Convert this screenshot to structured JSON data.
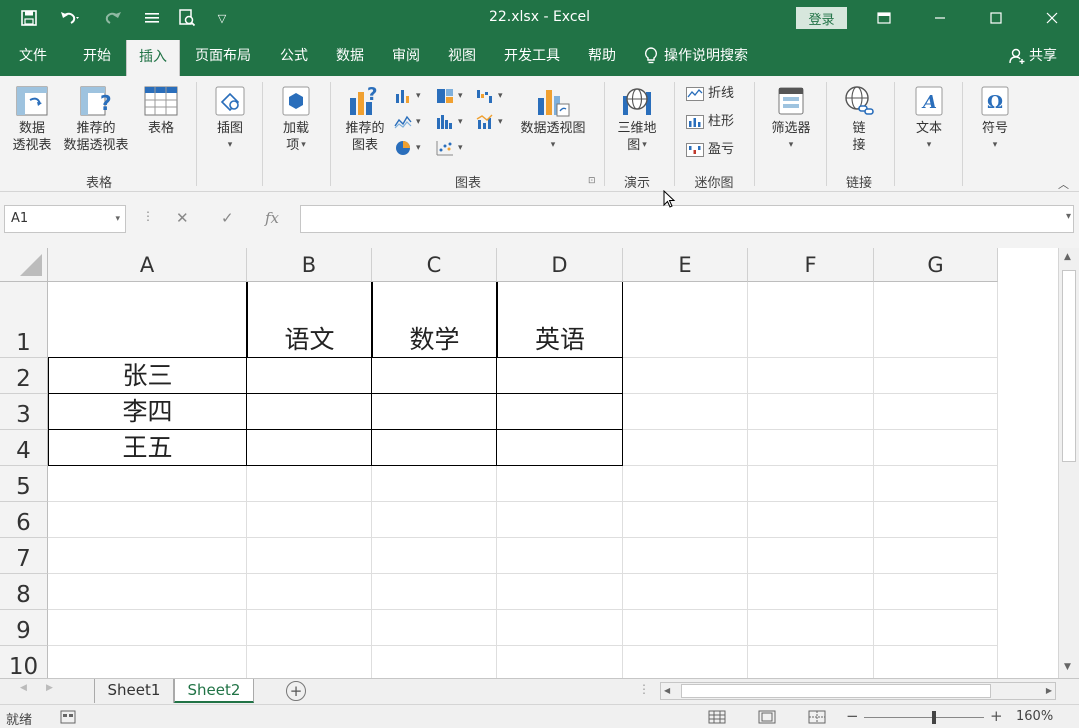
{
  "window": {
    "title": "22.xlsx - Excel",
    "login_label": "登录"
  },
  "tabs": [
    {
      "label": "文件"
    },
    {
      "label": "开始"
    },
    {
      "label": "插入"
    },
    {
      "label": "页面布局"
    },
    {
      "label": "公式"
    },
    {
      "label": "数据"
    },
    {
      "label": "审阅"
    },
    {
      "label": "视图"
    },
    {
      "label": "开发工具"
    },
    {
      "label": "帮助"
    }
  ],
  "tell_me": "操作说明搜索",
  "share_label": "共享",
  "ribbon": {
    "pivot_table": [
      "数据",
      "透视表"
    ],
    "recommended_pivot": [
      "推荐的",
      "数据透视表"
    ],
    "table": "表格",
    "group_tables": "表格",
    "illustrations": "插图",
    "addins": [
      "加载",
      "项"
    ],
    "recommended_charts": [
      "推荐的",
      "图表"
    ],
    "pivot_chart": "数据透视图",
    "group_charts": "图表",
    "map_3d": [
      "三维地",
      "图"
    ],
    "group_tours": "演示",
    "spark_line": "折线",
    "spark_column": "柱形",
    "spark_winloss": "盈亏",
    "group_sparklines": "迷你图",
    "slicer": "筛选器",
    "link": [
      "链",
      "接"
    ],
    "group_links": "链接",
    "text": "文本",
    "symbols": "符号"
  },
  "formula_bar": {
    "name_box": "A1",
    "fx": "fx"
  },
  "columns": [
    "A",
    "B",
    "C",
    "D",
    "E",
    "F",
    "G"
  ],
  "rows": [
    "1",
    "2",
    "3",
    "4",
    "5",
    "6",
    "7",
    "8",
    "9",
    "10"
  ],
  "cells": {
    "B1": "语文",
    "C1": "数学",
    "D1": "英语",
    "A2": "张三",
    "A3": "李四",
    "A4": "王五"
  },
  "sheets": [
    {
      "label": "Sheet1"
    },
    {
      "label": "Sheet2"
    }
  ],
  "status": {
    "ready": "就绪",
    "zoom": "160%"
  },
  "colors": {
    "brand": "#217346",
    "ribbon_bg": "#f3f3f3"
  }
}
